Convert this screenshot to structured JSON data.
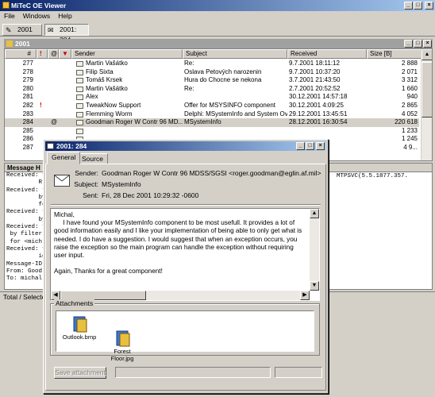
{
  "app": {
    "title": "MiTeC OE Viewer"
  },
  "menu": [
    "File",
    "Windows",
    "Help"
  ],
  "tabs": [
    {
      "label": "2001"
    },
    {
      "label": "2001: 284"
    }
  ],
  "folder_window": {
    "title": "2001"
  },
  "table": {
    "columns": [
      "#",
      "!",
      "@",
      "flag",
      "Sender",
      "Subject",
      "Received",
      "Size [B]"
    ],
    "rows": [
      {
        "num": "277",
        "prio": "",
        "att": "",
        "sender": "Martin Vašátko",
        "subject": "Re:",
        "received": "9.7.2001 18:11:12",
        "size": "2 888"
      },
      {
        "num": "278",
        "prio": "",
        "att": "",
        "sender": "Filip Sixta",
        "subject": "Oslava Petových narozenin",
        "received": "9.7.2001 10:37:20",
        "size": "2 071"
      },
      {
        "num": "279",
        "prio": "",
        "att": "",
        "sender": "Tomáš Krsek",
        "subject": "Hura do Chocne se nekona",
        "received": "3.7.2001 21:43:50",
        "size": "3 312"
      },
      {
        "num": "280",
        "prio": "",
        "att": "",
        "sender": "Martin Vašátko",
        "subject": "Re:",
        "received": "2.7.2001 20:52:52",
        "size": "1 660"
      },
      {
        "num": "281",
        "prio": "",
        "att": "",
        "sender": "Alex",
        "subject": "",
        "received": "30.12.2001 14:57:18",
        "size": "940"
      },
      {
        "num": "282",
        "prio": "!",
        "att": "",
        "sender": "TweakNow Support",
        "subject": "Offer for MSYSINFO component",
        "received": "30.12.2001 4:09:25",
        "size": "2 865"
      },
      {
        "num": "283",
        "prio": "",
        "att": "",
        "sender": "Flemming Worm",
        "subject": "Delphi: MSystemInfo and System Ove...",
        "received": "29.12.2001 13:45:51",
        "size": "4 052"
      },
      {
        "num": "284",
        "prio": "",
        "att": "@",
        "sender": "Goodman Roger W Contr 96 MD...",
        "subject": "MSystemInfo",
        "received": "28.12.2001 16:30:54",
        "size": "220 618"
      },
      {
        "num": "285",
        "prio": "",
        "att": "",
        "sender": "",
        "subject": "",
        "received": "",
        "size": "1 233"
      },
      {
        "num": "286",
        "prio": "",
        "att": "",
        "sender": "",
        "subject": "",
        "received": "",
        "size": "1 245"
      },
      {
        "num": "287",
        "prio": "",
        "att": "",
        "sender": "",
        "subject": "",
        "received": "",
        "size": "4 9..."
      }
    ]
  },
  "message_pane": {
    "header": "Message H",
    "right_text": "MTPSVC(5.5.1877.357.",
    "lines": [
      "Received: f",
      "         R",
      "Received: f",
      "         by",
      "         fo",
      "Received: f",
      "         by",
      "Received: f",
      " by filter",
      " for <mich",
      "Received: f",
      "         id",
      "Message-ID",
      "From: Good",
      "To: michal"
    ]
  },
  "status": {
    "text": "Total / Selecte"
  },
  "dialog": {
    "title": "2001: 284",
    "tabs": [
      "General",
      "Source"
    ],
    "sender_label": "Sender:",
    "sender_value": "Goodman Roger W Contr 96 MDSS/SGSI <roger.goodman@eglin.af.mil>",
    "subject_label": "Subject:",
    "subject_value": "MSystemInfo",
    "sent_label": "Sent:",
    "sent_value": "Fri, 28 Dec 2001 10:29:32 -0600",
    "body": "Michal,\n     I have found your MSystemInfo component to be most usefull. It provides a lot of good information easily and I like your implementation of being able to only get what is needed. I do have a suggestion. I would suggest that when an exception occurs, you raise the exception so the main program can handle the exception without requiring user input.\n\nAgain, Thanks for a great component!",
    "attachments_label": "Attachments",
    "attachments": [
      {
        "name": "Outlook.bmp"
      },
      {
        "name": "Forest\nFloor.jpg"
      }
    ],
    "save_button": "Save attachment"
  },
  "colors": {
    "titlebar_start": "#0a246a",
    "titlebar_end": "#a6caf0",
    "face": "#d4d0c8",
    "priority_red": "#cc0000"
  }
}
